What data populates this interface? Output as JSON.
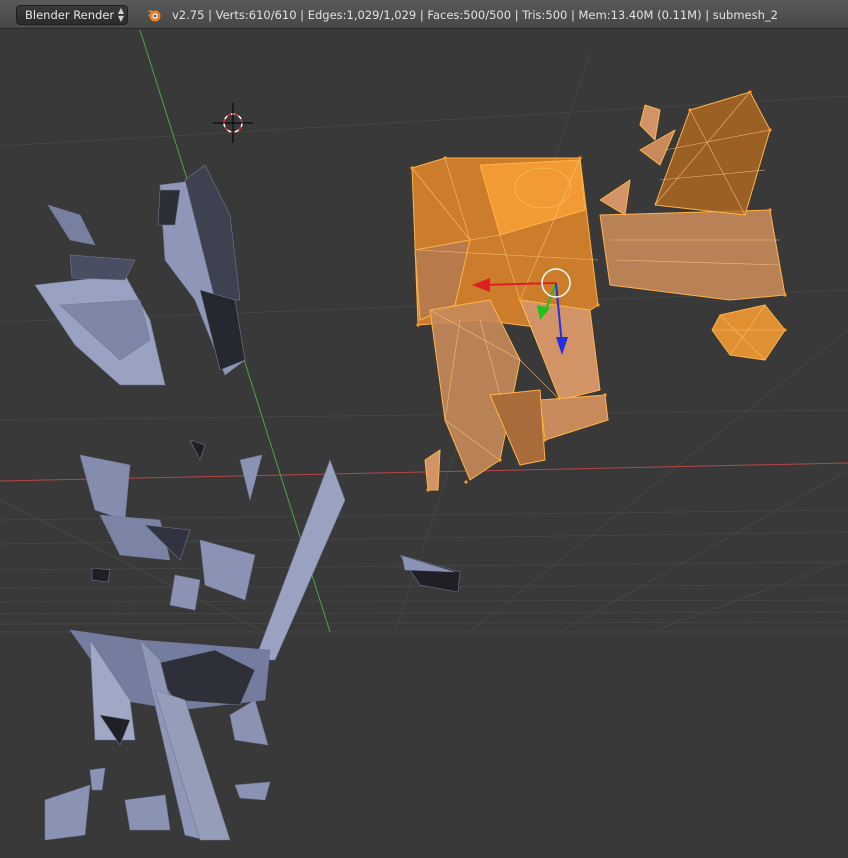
{
  "header": {
    "render_engine": "Blender Render",
    "stats": "v2.75 | Verts:610/610 | Edges:1,029/1,029 | Faces:500/500 | Tris:500 | Mem:13.40M (0.11M) | submesh_2"
  },
  "icons": {
    "engine_dropdown": "updown-arrow-icon",
    "logo": "blender-logo-icon",
    "cursor": "3d-cursor-icon",
    "manipulator": "transform-manipulator-icon"
  },
  "colors": {
    "background": "#393939",
    "selected_mesh": "#f39a2b",
    "unselected_mesh": "#8b93b4",
    "x_axis": "#b84545",
    "y_axis": "#4aa34a"
  }
}
